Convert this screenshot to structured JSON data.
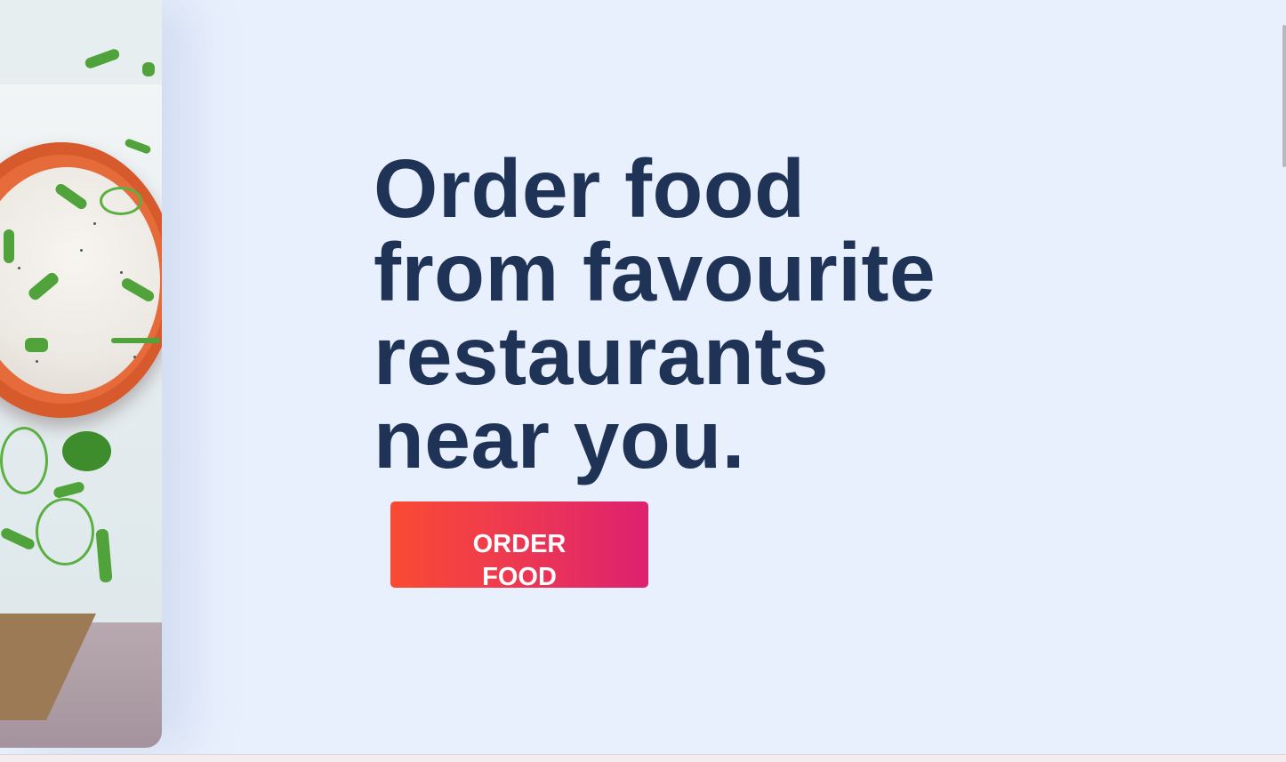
{
  "hero": {
    "headline_lines": [
      "Order food",
      "from favourite",
      "restaurants",
      "near you."
    ]
  },
  "cta": {
    "lines": [
      "ORDER",
      "FOOD"
    ]
  },
  "colors": {
    "background": "#e9f0fd",
    "headline": "#1f3357",
    "cta_gradient_start": "#fa4a32",
    "cta_gradient_end": "#dd216f",
    "cta_text": "#ffffff"
  },
  "images": {
    "hero_image": "bowl of sour cream dip with chopped green onions"
  }
}
